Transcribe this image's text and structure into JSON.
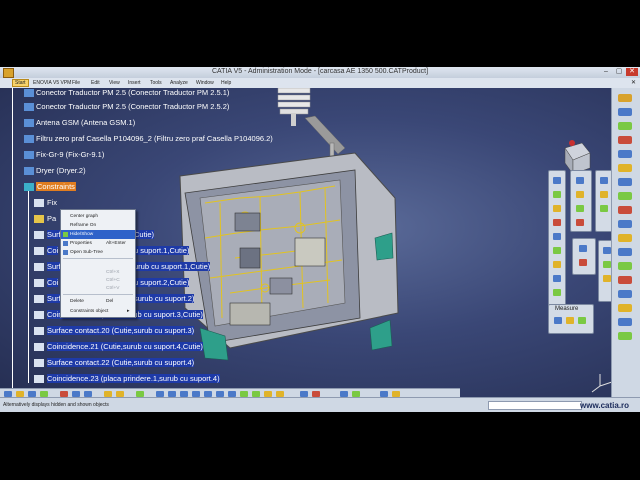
{
  "window": {
    "title": "CATIA V5 - Administration Mode - [carcasa AE 1350 500.CATProduct]",
    "controls": [
      "–",
      "▢",
      "✕"
    ]
  },
  "menubar": [
    "Start",
    "ENOVIA V5 VPM",
    "File",
    "Edit",
    "View",
    "Insert",
    "Tools",
    "Analyze",
    "Window",
    "Help"
  ],
  "tree": {
    "items": [
      {
        "label": "Conector Traductor PM 2.5 (Conector Traductor PM 2.5.1)"
      },
      {
        "label": "Conector Traductor PM 2.5 (Conector Traductor PM 2.5.2)"
      },
      {
        "label": "Antena GSM (Antena GSM.1)"
      },
      {
        "label": "Filtru zero praf Casella P104096_2 (Filtru zero praf Casella P104096.2)"
      },
      {
        "label": "Fix-Gr-9 (Fix-Gr-9.1)"
      },
      {
        "label": "Dryer (Dryer.2)"
      },
      {
        "label": "Constraints"
      },
      {
        "label": "Fix"
      },
      {
        "label": "Pa"
      },
      {
        "label": "Surf",
        "suffix": "Cutie)"
      },
      {
        "label": "Coi",
        "suffix": "u suport.1,Cutie)"
      },
      {
        "label": "Surf",
        "suffix": "urub cu suport.1,Cutie)"
      },
      {
        "label": "Coi",
        "suffix": "u suport.2,Cutie)"
      },
      {
        "label": "Surf",
        "suffix": "surub cu suport.2)"
      },
      {
        "label": "Coincidence.19 (Cutie,surub cu suport.3,Cutie)"
      },
      {
        "label": "Surface contact.20 (Cutie,surub cu suport.3)"
      },
      {
        "label": "Coincidence.21 (Cutie,surub cu suport.4,Cutie)"
      },
      {
        "label": "Surface contact.22 (Cutie,surub cu suport.4)"
      },
      {
        "label": "Coincidence.23 (placa prindere.1,surub cu suport.4)"
      }
    ]
  },
  "context_menu": {
    "items": [
      {
        "label": "Center graph",
        "accel": ""
      },
      {
        "label": "Reframe On",
        "accel": ""
      },
      {
        "label": "Hide/Show",
        "accel": "",
        "selected": true
      },
      {
        "label": "Properties",
        "accel": "Alt+Enter"
      },
      {
        "label": "Open Sub-Tree",
        "accel": ""
      },
      {
        "label": "",
        "accel": "",
        "disabled": true
      },
      {
        "label": "",
        "accel": "Ctrl+X",
        "disabled": true
      },
      {
        "label": "",
        "accel": "Ctrl+C",
        "disabled": true
      },
      {
        "label": "",
        "accel": "Ctrl+V",
        "disabled": true
      },
      {
        "label": "",
        "accel": "",
        "disabled": true
      },
      {
        "label": "Delete",
        "accel": "Del"
      },
      {
        "label": "Constraints object",
        "accel": "▸"
      }
    ]
  },
  "measure_panel": {
    "title": "Measure"
  },
  "statusbar": {
    "message": "Alternatively displays hidden and shown objects",
    "logo": "www.catia.ro"
  },
  "colors": {
    "viewport_bg": "#3a4776",
    "highlight": "#1e3aa8",
    "accent": "#d8a22c"
  }
}
